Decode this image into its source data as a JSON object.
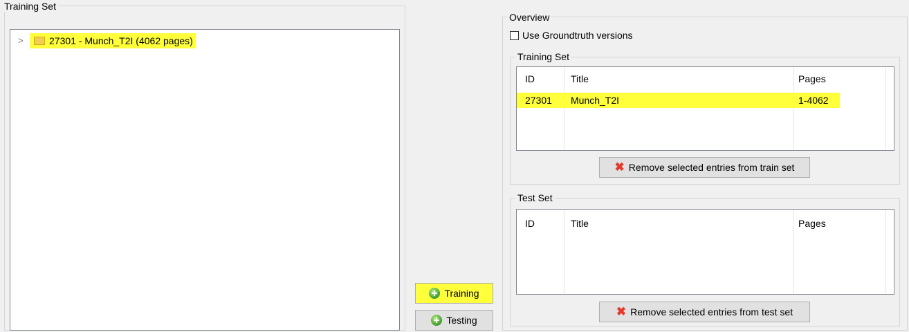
{
  "left": {
    "group_title": "Training Set",
    "tree": [
      {
        "expander": ">",
        "label": "27301 - Munch_T2I (4062 pages)",
        "highlighted": true
      }
    ]
  },
  "middle": {
    "training_label": "Training",
    "testing_label": "Testing"
  },
  "overview": {
    "group_title": "Overview",
    "use_groundtruth_label": "Use Groundtruth versions",
    "use_groundtruth_checked": false,
    "training_set": {
      "group_title": "Training Set",
      "columns": [
        "ID",
        "Title",
        "Pages"
      ],
      "rows": [
        {
          "id": "27301",
          "title": "Munch_T2I",
          "pages": "1-4062",
          "highlighted": true
        }
      ],
      "remove_label": "Remove selected entries from train set"
    },
    "test_set": {
      "group_title": "Test Set",
      "columns": [
        "ID",
        "Title",
        "Pages"
      ],
      "rows": [],
      "remove_label": "Remove selected entries from test set"
    }
  },
  "colors": {
    "highlight": "#ffff3c",
    "window_bg": "#f0f0f0",
    "remove_icon": "#e43a2b",
    "add_icon": "#3d9a2a"
  }
}
